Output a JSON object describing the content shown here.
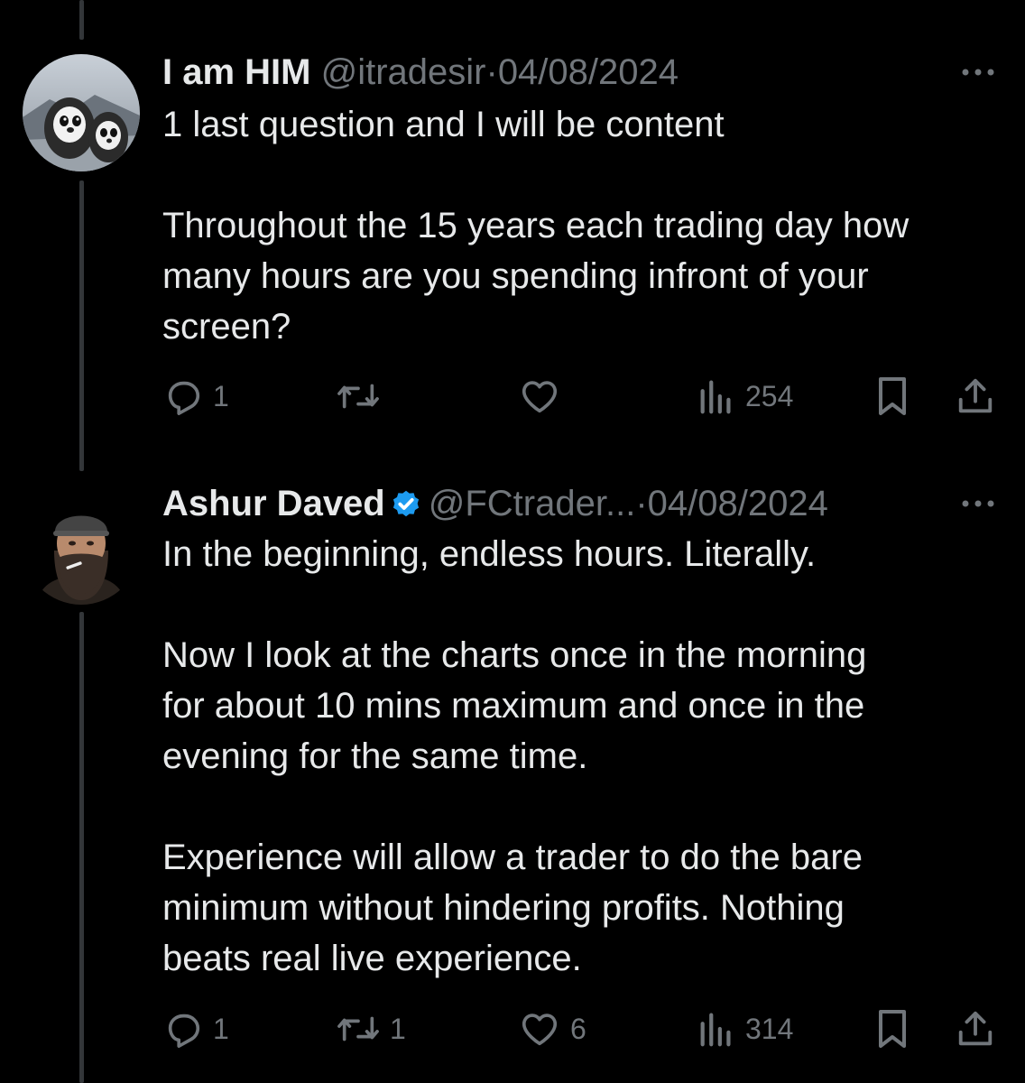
{
  "tweets": [
    {
      "display_name": "I am HIM",
      "handle": "@itradesir",
      "separator": "·",
      "date": "04/08/2024",
      "verified": false,
      "text": "1 last question and I will be content\n\nThroughout the 15 years each trading day how\nmany hours are you spending infront of your\nscreen?",
      "avatar_icon": "penguins-avatar",
      "more_icon": "more-icon",
      "actions": {
        "reply_count": "1",
        "retweet_count": "",
        "like_count": "",
        "view_count": "254"
      }
    },
    {
      "display_name": "Ashur Daved",
      "handle": "@FCtrader...",
      "separator": "·",
      "date": "04/08/2024",
      "verified": true,
      "verified_color": "#1d9bf0",
      "text": "In the beginning, endless hours. Literally.\n\nNow I look at the charts once in the morning\nfor about 10 mins maximum and once in the\nevening for the same time.\n\nExperience will allow a trader to do the bare\nminimum without hindering profits. Nothing\nbeats real live experience.",
      "avatar_icon": "bearded-man-avatar",
      "more_icon": "more-icon",
      "actions": {
        "reply_count": "1",
        "retweet_count": "1",
        "like_count": "6",
        "view_count": "314"
      }
    }
  ],
  "icons": {
    "reply": "reply-icon",
    "retweet": "retweet-icon",
    "like": "heart-icon",
    "views": "views-icon",
    "bookmark": "bookmark-icon",
    "share": "share-icon",
    "verified": "verified-badge-icon"
  },
  "colors": {
    "background": "#000000",
    "text": "#e7e9ea",
    "muted": "#71767b",
    "thread_line": "#333639",
    "verified": "#1d9bf0"
  }
}
